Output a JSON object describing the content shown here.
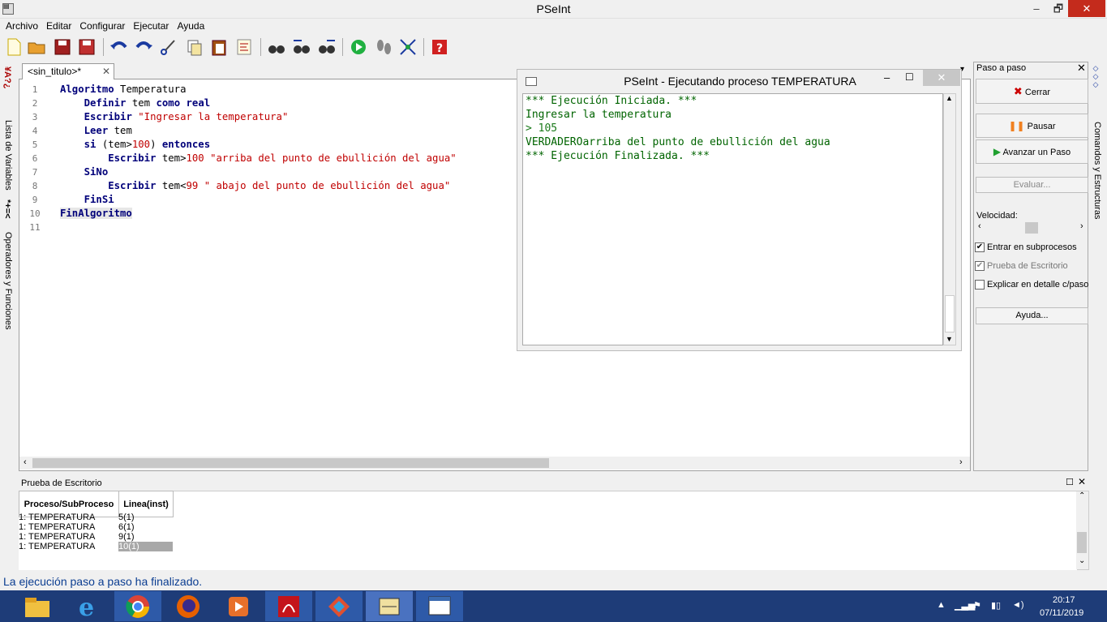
{
  "window": {
    "title": "PSeInt",
    "controls": [
      "–",
      "🗗",
      "✕"
    ]
  },
  "menu": [
    "Archivo",
    "Editar",
    "Configurar",
    "Ejecutar",
    "Ayuda"
  ],
  "toolbar": {
    "icons": [
      "new-file-icon",
      "open-folder-icon",
      "save-icon",
      "save-as-icon",
      "undo-icon",
      "redo-icon",
      "cut-icon",
      "copy-icon",
      "paste-icon",
      "format-icon",
      "find-icon",
      "find-prev-icon",
      "find-next-icon",
      "run-icon",
      "step-icon",
      "flowchart-icon",
      "help-icon"
    ]
  },
  "left_strip": {
    "vars": "Lista de Variables",
    "ops": "Operadores y Funciones"
  },
  "right_strip": {
    "label": "Comandos y Estructuras"
  },
  "editor": {
    "tab": "<sin_titulo>*",
    "line_numbers": [
      "1",
      "2",
      "3",
      "4",
      "5",
      "6",
      "7",
      "8",
      "9",
      "10",
      "11"
    ]
  },
  "exec_window": {
    "title": "PSeInt - Ejecutando proceso TEMPERATURA",
    "lines": [
      "*** Ejecución Iniciada. ***",
      "Ingresar la temperatura",
      "> 105",
      "VERDADEROarriba del punto de ebullición del agua",
      "*** Ejecución Finalizada. ***"
    ]
  },
  "step_panel": {
    "title": "Paso a paso",
    "cerrar": "Cerrar",
    "pausar": "Pausar",
    "avanzar": "Avanzar un Paso",
    "evaluar": "Evaluar...",
    "velocidad": "Velocidad:",
    "entrar": "Entrar en subprocesos",
    "prueba": "Prueba de Escritorio",
    "explicar": "Explicar en detalle c/paso",
    "ayuda": "Ayuda..."
  },
  "desk": {
    "title": "Prueba de Escritorio",
    "headers": [
      "Proceso/SubProceso",
      "Linea(inst)"
    ],
    "rows": [
      [
        "1: TEMPERATURA",
        "5(1)"
      ],
      [
        "1: TEMPERATURA",
        "6(1)"
      ],
      [
        "1: TEMPERATURA",
        "9(1)"
      ],
      [
        "1: TEMPERATURA",
        "10(1)"
      ]
    ]
  },
  "status": "La ejecución paso a paso ha finalizado.",
  "taskbar": {
    "time": "20:17",
    "date": "07/11/2019"
  },
  "colors": {
    "keyword": "#00007a",
    "string": "#c00000",
    "output": "#006400",
    "taskbar": "#1e3c78",
    "close": "#c42b1c"
  }
}
